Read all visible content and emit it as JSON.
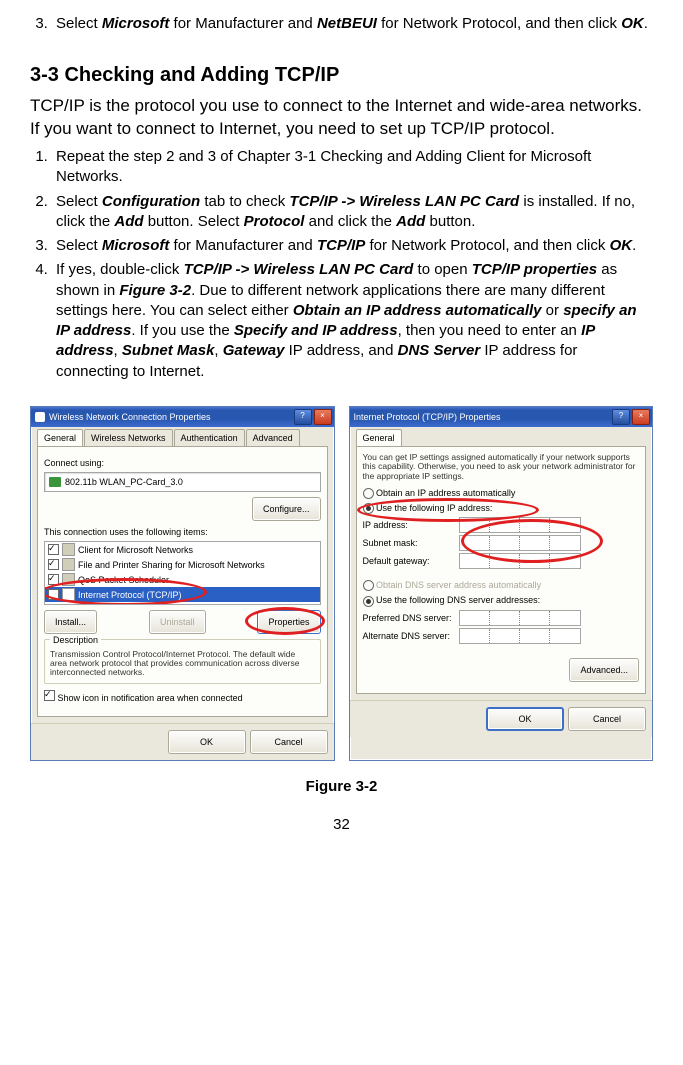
{
  "step3_prev": {
    "num": "3.",
    "text_a": "Select ",
    "bold1": "Microsoft",
    "text_b": " for Manufacturer and ",
    "bold2": "NetBEUI",
    "text_c": " for Network Protocol, and then click ",
    "bold3": "OK",
    "text_d": "."
  },
  "heading": "3-3 Checking and Adding TCP/IP",
  "intro": "TCP/IP is the protocol you use to connect to the Internet and wide-area networks. If you want to connect to Internet, you need to set up TCP/IP protocol.",
  "steps": {
    "s1": "Repeat the step 2 and 3 of Chapter 3-1 Checking and Adding Client for Microsoft Networks.",
    "s2_a": "Select ",
    "s2_b1": "Configuration",
    "s2_b": " tab to check ",
    "s2_b2": "TCP/IP -> Wireless LAN PC Card",
    "s2_c": " is installed. If no, click the ",
    "s2_b3": "Add",
    "s2_d": " button. Select ",
    "s2_b4": "Protocol",
    "s2_e": " and click the ",
    "s2_b5": "Add",
    "s2_f": " button.",
    "s3_a": "Select ",
    "s3_b1": "Microsoft",
    "s3_b": " for Manufacturer and ",
    "s3_b2": "TCP/IP",
    "s3_c": " for Network Protocol, and then click ",
    "s3_b3": "OK",
    "s3_d": ".",
    "s4_a": "If yes, double-click ",
    "s4_b1": "TCP/IP -> Wireless LAN PC Card",
    "s4_b": " to open ",
    "s4_b2": "TCP/IP properties",
    "s4_c": " as shown in ",
    "s4_b3": "Figure 3-2",
    "s4_d": ". Due to different network applications there are many different settings here. You can select either ",
    "s4_b4": "Obtain an IP address automatically",
    "s4_e": " or ",
    "s4_b5": "specify an IP address",
    "s4_f": ". If you use the ",
    "s4_b6": "Specify and IP address",
    "s4_g": ", then you need to enter an ",
    "s4_b7": "IP address",
    "s4_h": ", ",
    "s4_b8": "Subnet Mask",
    "s4_i": ", ",
    "s4_b9": "Gateway",
    "s4_j": " IP address, and ",
    "s4_b10": "DNS Server",
    "s4_k": " IP address for connecting to Internet."
  },
  "win1": {
    "title": "Wireless Network Connection Properties",
    "tabs": [
      "General",
      "Wireless Networks",
      "Authentication",
      "Advanced"
    ],
    "connect_label": "Connect using:",
    "adapter": "802.11b WLAN_PC-Card_3.0",
    "configure_btn": "Configure...",
    "uses_label": "This connection uses the following items:",
    "items": [
      "Client for Microsoft Networks",
      "File and Printer Sharing for Microsoft Networks",
      "QoS Packet Scheduler",
      "Internet Protocol (TCP/IP)"
    ],
    "install_btn": "Install...",
    "uninstall_btn": "Uninstall",
    "properties_btn": "Properties",
    "desc_label": "Description",
    "desc_text": "Transmission Control Protocol/Internet Protocol. The default wide area network protocol that provides communication across diverse interconnected networks.",
    "show_icon": "Show icon in notification area when connected",
    "ok": "OK",
    "cancel": "Cancel"
  },
  "win2": {
    "title": "Internet Protocol (TCP/IP) Properties",
    "tab": "General",
    "hint": "You can get IP settings assigned automatically if your network supports this capability. Otherwise, you need to ask your network administrator for the appropriate IP settings.",
    "r1": "Obtain an IP address automatically",
    "r2": "Use the following IP address:",
    "ip": "IP address:",
    "subnet": "Subnet mask:",
    "gateway": "Default gateway:",
    "r3": "Obtain DNS server address automatically",
    "r4": "Use the following DNS server addresses:",
    "pdns": "Preferred DNS server:",
    "adns": "Alternate DNS server:",
    "advanced": "Advanced...",
    "ok": "OK",
    "cancel": "Cancel"
  },
  "figure_caption": "Figure 3-2",
  "page_number": "32"
}
